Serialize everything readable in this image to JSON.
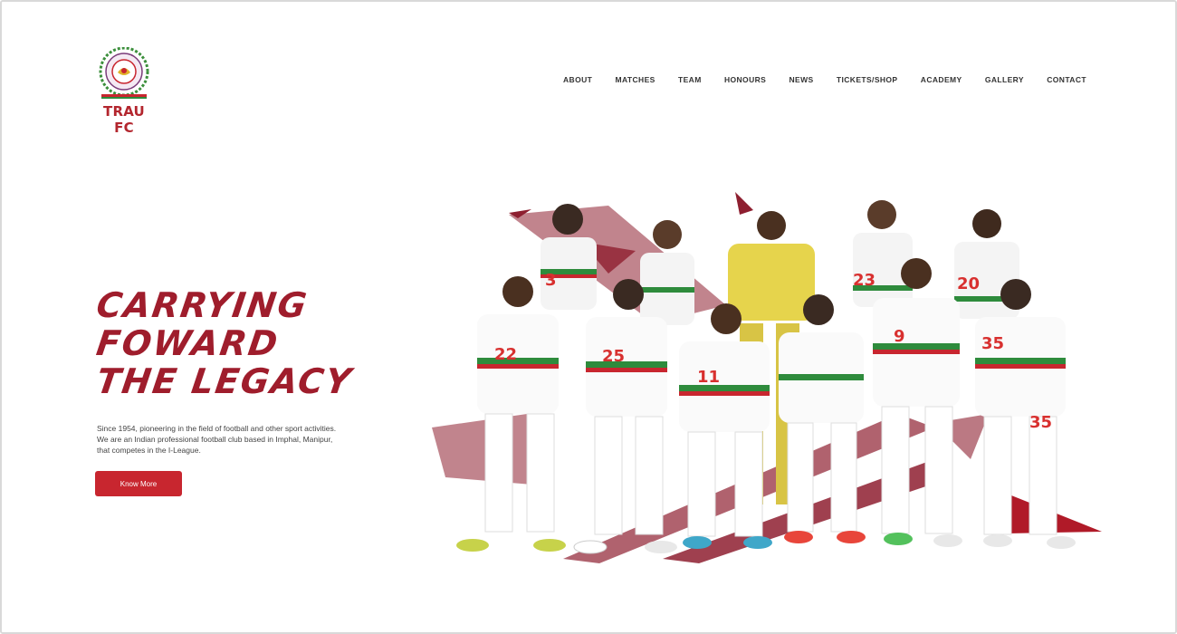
{
  "brand": {
    "name": "TRAU FC",
    "colors": {
      "primary": "#9f1d2c",
      "accent": "#c8262f",
      "green": "#2e8b3c",
      "gold": "#e0b32a"
    }
  },
  "nav": {
    "items": [
      {
        "label": "ABOUT"
      },
      {
        "label": "MATCHES"
      },
      {
        "label": "TEAM"
      },
      {
        "label": "HONOURS"
      },
      {
        "label": "NEWS"
      },
      {
        "label": "TICKETS/SHOP"
      },
      {
        "label": "ACADEMY"
      },
      {
        "label": "GALLERY"
      },
      {
        "label": "CONTACT"
      }
    ]
  },
  "hero": {
    "headline": [
      "CARRYING",
      "FOWARD",
      "THE LEGACY"
    ],
    "description": [
      "Since 1954, pioneering in the field of football and other sport activities.",
      "We are an Indian professional football club based in Imphal, Manipur,",
      "that competes in the I-League."
    ],
    "cta_label": "Know More"
  },
  "team_photo": {
    "icon": "team-group-photo",
    "jersey_numbers": [
      "3",
      "23",
      "20",
      "22",
      "25",
      "11",
      "9",
      "35",
      "35"
    ]
  }
}
